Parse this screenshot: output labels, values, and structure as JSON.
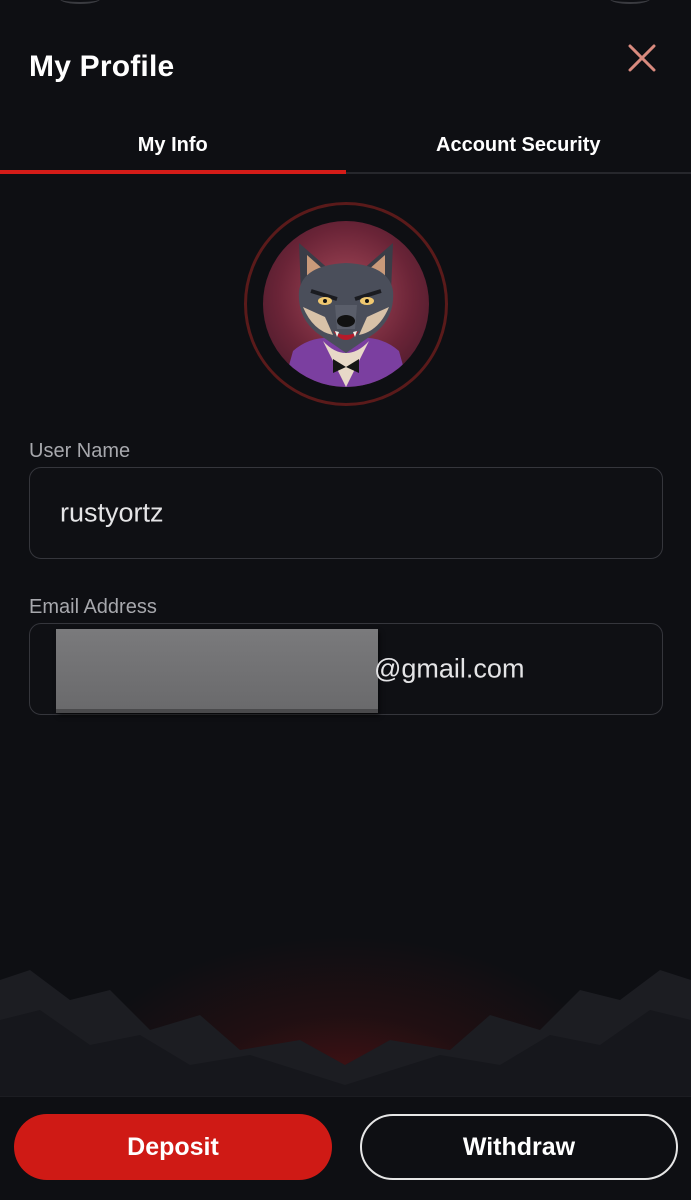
{
  "header": {
    "title": "My Profile",
    "close_icon": "close-icon",
    "close_color": "#d88a7e"
  },
  "tabs": [
    {
      "label": "My Info",
      "active": true
    },
    {
      "label": "Account Security",
      "active": false
    }
  ],
  "avatar": {
    "icon": "wolf-avatar"
  },
  "form": {
    "username_label": "User Name",
    "username_value": "rustyortz",
    "email_label": "Email Address",
    "email_value_visible": "@gmail.com"
  },
  "actions": {
    "deposit_label": "Deposit",
    "withdraw_label": "Withdraw"
  },
  "colors": {
    "accent": "#cf1a15",
    "background": "#0e0f13"
  }
}
